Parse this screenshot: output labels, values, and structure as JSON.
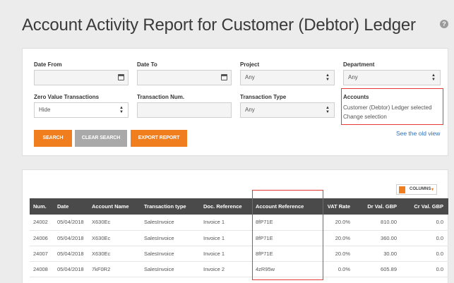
{
  "page": {
    "title": "Account Activity Report for Customer (Debtor) Ledger"
  },
  "help": {
    "icon_label": "?"
  },
  "filters": {
    "date_from": {
      "label": "Date From",
      "value": ""
    },
    "date_to": {
      "label": "Date To",
      "value": ""
    },
    "project": {
      "label": "Project",
      "value": "Any"
    },
    "department": {
      "label": "Department",
      "value": "Any"
    },
    "zero_value": {
      "label": "Zero Value Transactions",
      "value": "Hide"
    },
    "transaction_num": {
      "label": "Transaction Num.",
      "value": ""
    },
    "transaction_type": {
      "label": "Transaction Type",
      "value": "Any"
    },
    "accounts": {
      "label": "Accounts",
      "selected_text": "Customer (Debtor) Ledger selected",
      "change_link": "Change selection"
    }
  },
  "buttons": {
    "search": "SEARCH",
    "clear_search": "CLEAR SEARCH",
    "export_report": "EXPORT REPORT"
  },
  "links": {
    "old_view": "See the old view"
  },
  "columns_button": {
    "label": "COLUMNS",
    "caret": "▾"
  },
  "colors": {
    "accent": "#f07d1e",
    "header_bg": "#4a4a4a",
    "highlight": "#e53935",
    "link": "#2f6fb7"
  },
  "table": {
    "headers": [
      "Num.",
      "Date",
      "Account Name",
      "Transaction type",
      "Doc. Reference",
      "Account Reference",
      "VAT Rate",
      "Dr Val. GBP",
      "Cr Val. GBP"
    ],
    "rows": [
      [
        "24002",
        "05/04/2018",
        "X630Ec",
        "SalesInvoice",
        "Invoice 1",
        "8fP71E",
        "20.0%",
        "810.00",
        "0.0"
      ],
      [
        "24006",
        "05/04/2018",
        "X630Ec",
        "SalesInvoice",
        "Invoice 1",
        "8fP71E",
        "20.0%",
        "360.00",
        "0.0"
      ],
      [
        "24007",
        "05/04/2018",
        "X630Ec",
        "SalesInvoice",
        "Invoice 1",
        "8fP71E",
        "20.0%",
        "30.00",
        "0.0"
      ],
      [
        "24008",
        "05/04/2018",
        "7kF0R2",
        "SalesInvoice",
        "Invoice 2",
        "4zR95w",
        "0.0%",
        "605.89",
        "0.0"
      ]
    ]
  }
}
